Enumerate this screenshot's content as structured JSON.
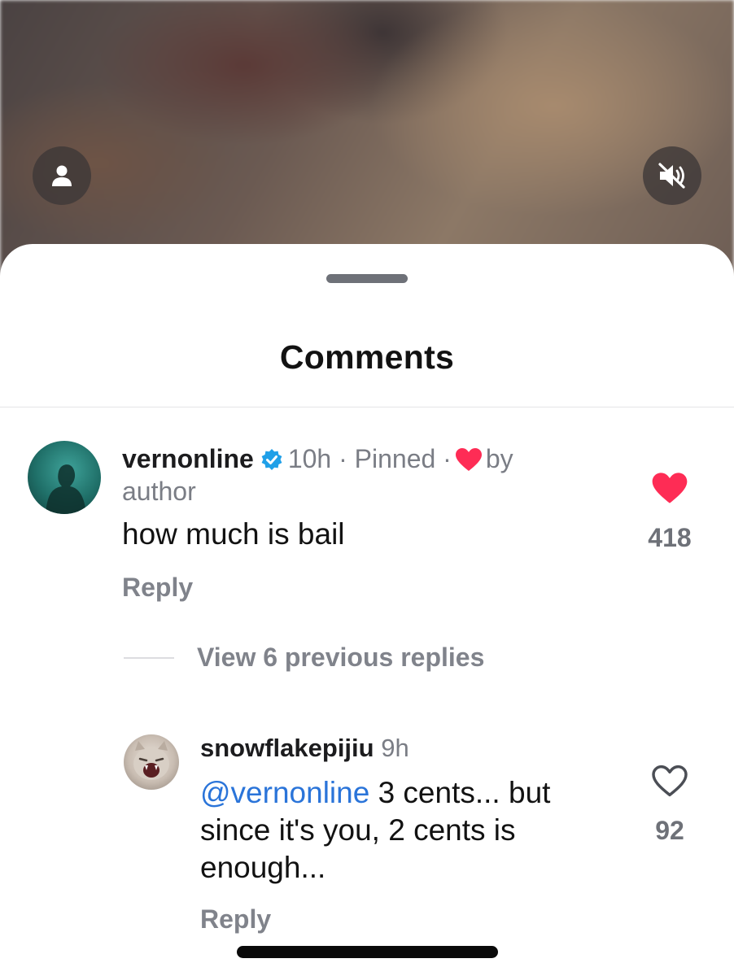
{
  "video": {
    "profile_icon": "person-icon",
    "mute_icon": "speaker-muted-icon"
  },
  "sheet": {
    "title": "Comments"
  },
  "comments": [
    {
      "username": "vernonline",
      "verified": true,
      "time": "10h",
      "meta": "· Pinned ·",
      "liked_by_author_label": "by author",
      "text": "how much is bail",
      "reply_label": "Reply",
      "like_count": "418",
      "liked": true
    }
  ],
  "view_replies_label": "View 6 previous replies",
  "replies": [
    {
      "username": "snowflakepijiu",
      "time": "9h",
      "mention": "@vernonline",
      "text": " 3 cents... but since it's you, 2 cents is enough...",
      "reply_label": "Reply",
      "like_count": "92",
      "liked": false
    }
  ],
  "colors": {
    "like_red": "#fe2c55",
    "mention_blue": "#2a74d9",
    "verified_blue": "#20d5ec"
  }
}
